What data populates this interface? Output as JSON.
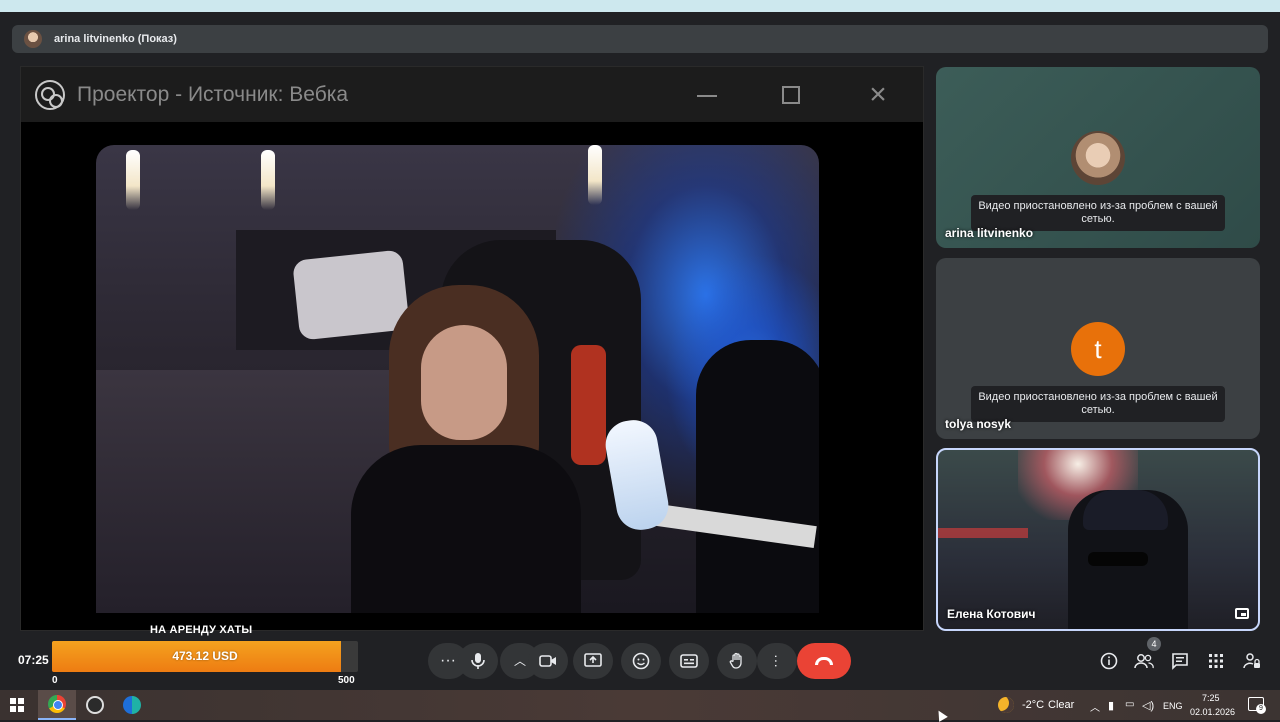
{
  "presenter_bar": {
    "text": "arina litvinenko (Показ)"
  },
  "projector_window": {
    "title": "Проектор - Источник: Вебка",
    "minimize_icon": "minimize-icon",
    "maximize_icon": "maximize-icon",
    "close_icon": "close-icon"
  },
  "participants": [
    {
      "name": "arina litvinenko",
      "avatar": "photo",
      "status": "Видео приостановлено из-за проблем с вашей сетью."
    },
    {
      "name": "tolya nosyk",
      "avatar_letter": "t",
      "avatar_color": "#e8710a",
      "status": "Видео приостановлено из-за проблем с вашей сетью."
    },
    {
      "name": "Елена Котович",
      "avatar": "video"
    }
  ],
  "footer": {
    "time": "07:25",
    "donation_goal": {
      "label": "НА АРЕНДУ ХАТЫ",
      "value_text": "473.12 USD",
      "min": "0",
      "max": "500",
      "progress": 0.946,
      "fill_color": "#f08a16"
    },
    "controls": [
      "more-options",
      "microphone",
      "camera-options",
      "camera",
      "present-screen",
      "reactions",
      "captions",
      "raise-hand",
      "more-vertical",
      "leave-call"
    ],
    "right_icons": {
      "info": "info-icon",
      "people": "people-icon",
      "people_count": "4",
      "chat": "chat-icon",
      "activities": "apps-icon",
      "host_controls": "lock-person-icon"
    },
    "end_call_color": "#ea4335"
  },
  "taskbar": {
    "weather_temp": "-2°C",
    "weather_text": "Clear",
    "language": "ENG",
    "clock_time": "7:25",
    "clock_date": "02.01.2026",
    "notification_count": "9"
  }
}
